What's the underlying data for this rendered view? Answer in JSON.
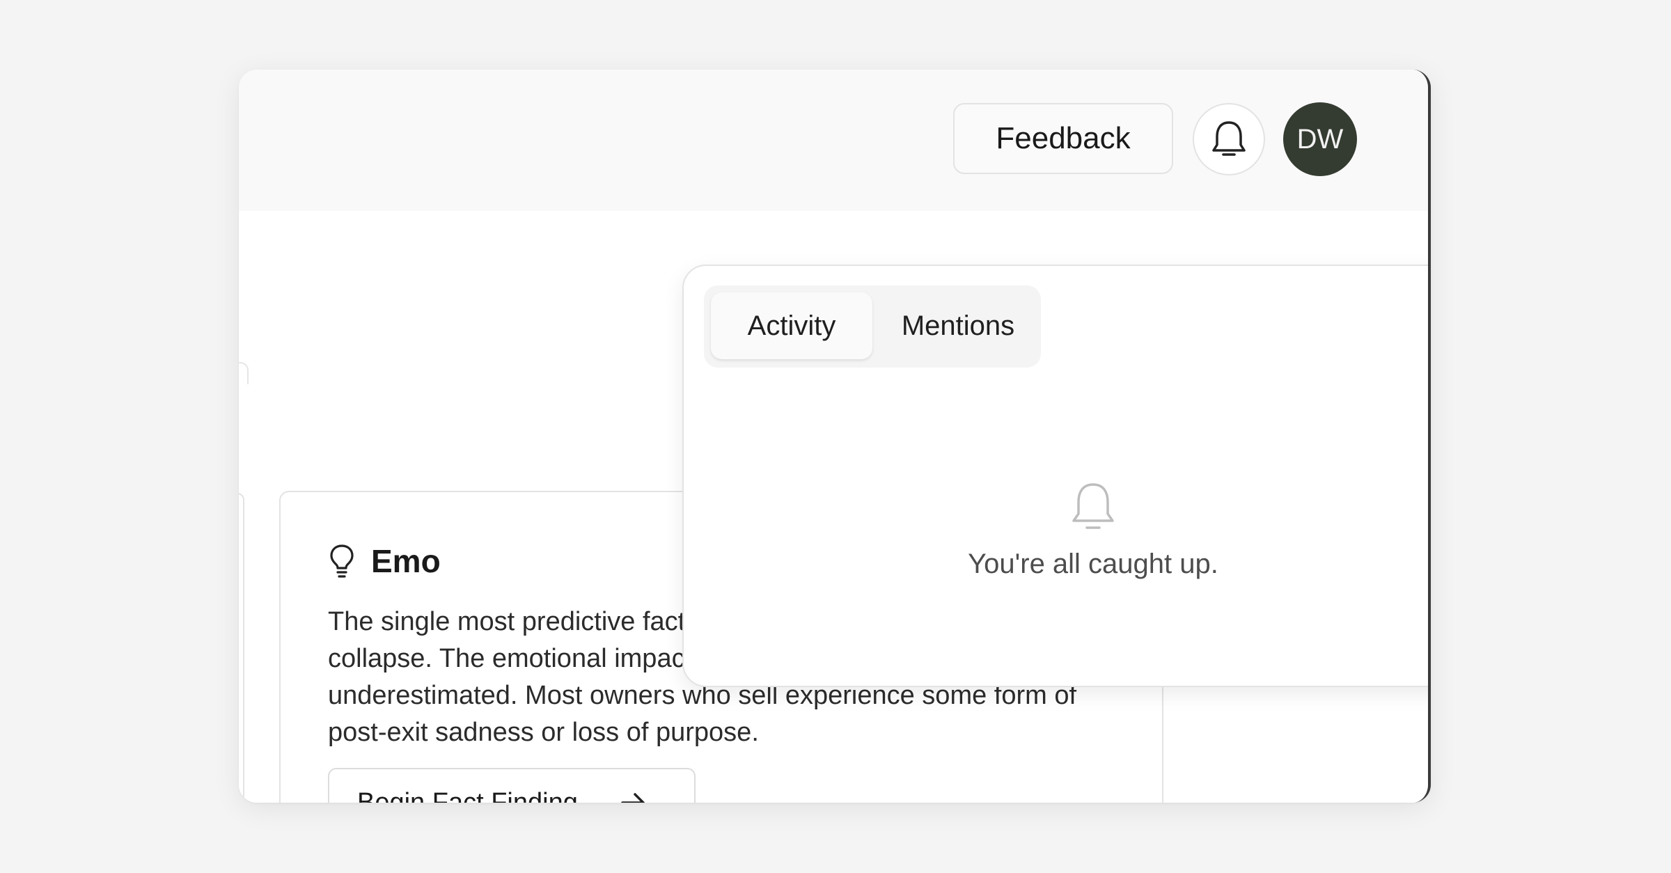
{
  "header": {
    "feedback_label": "Feedback",
    "bell_icon": "bell-icon",
    "avatar_initials": "DW",
    "avatar_color": "#343b30"
  },
  "card": {
    "icon": "lightbulb-icon",
    "title": "Emo",
    "body": "The single most predictive factor for whether a deal will close or collapse. The emotional impact of stepping away is consistently underestimated. Most owners who sell experience some form of post-exit sadness or loss of purpose.",
    "button_label": "Begin Fact Finding",
    "button_icon": "arrow-right-icon"
  },
  "notifications": {
    "tabs": [
      {
        "label": "Activity",
        "active": true
      },
      {
        "label": "Mentions",
        "active": false
      }
    ],
    "empty_icon": "bell-icon",
    "empty_text": "You're all caught up."
  }
}
